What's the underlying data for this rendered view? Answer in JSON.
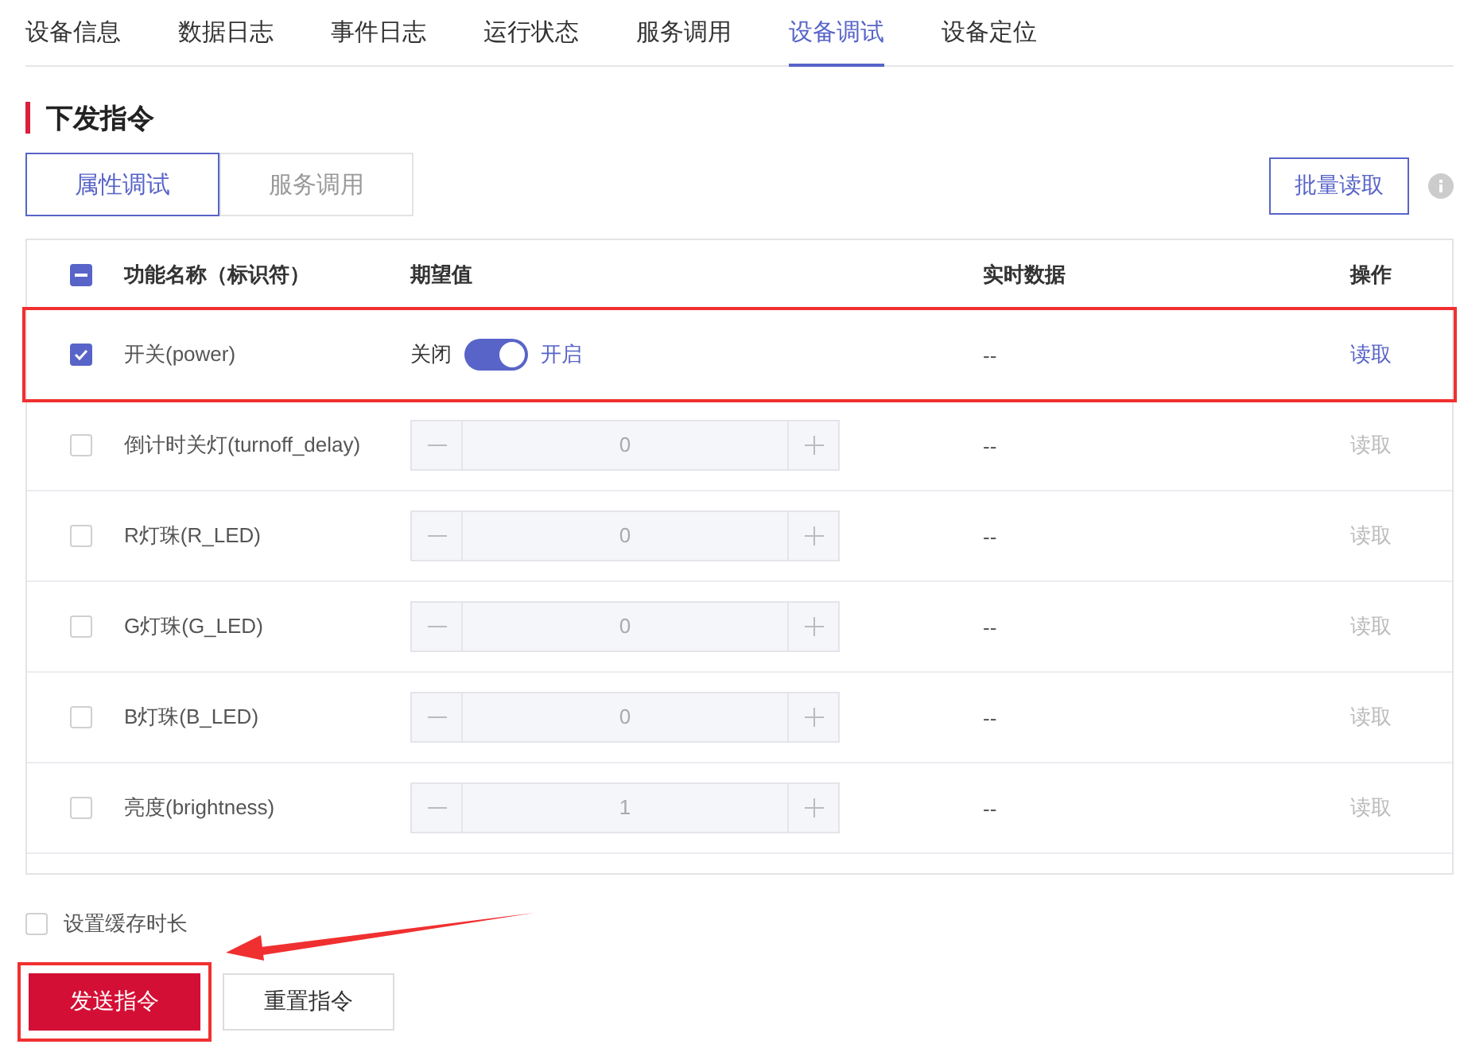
{
  "tabs": [
    {
      "label": "设备信息",
      "selected": false
    },
    {
      "label": "数据日志",
      "selected": false
    },
    {
      "label": "事件日志",
      "selected": false
    },
    {
      "label": "运行状态",
      "selected": false
    },
    {
      "label": "服务调用",
      "selected": false
    },
    {
      "label": "设备调试",
      "selected": true
    },
    {
      "label": "设备定位",
      "selected": false
    }
  ],
  "section_title": "下发指令",
  "subtabs": [
    {
      "label": "属性调试",
      "selected": true
    },
    {
      "label": "服务调用",
      "selected": false
    }
  ],
  "batch_button": "批量读取",
  "table": {
    "header_checkbox": {
      "indeterminate": true
    },
    "columns": [
      "功能名称（标识符）",
      "期望值",
      "实时数据",
      "操作"
    ],
    "rows": [
      {
        "kind": "switch",
        "checked": true,
        "highlighted": true,
        "name": "开关(power)",
        "off_label": "关闭",
        "on": true,
        "on_label": "开启",
        "realtime": "--",
        "action": "读取",
        "disabled": false
      },
      {
        "kind": "stepper",
        "checked": false,
        "highlighted": false,
        "name": "倒计时关灯(turnoff_delay)",
        "value": "0",
        "realtime": "--",
        "action": "读取",
        "disabled": true
      },
      {
        "kind": "stepper",
        "checked": false,
        "highlighted": false,
        "name": "R灯珠(R_LED)",
        "value": "0",
        "realtime": "--",
        "action": "读取",
        "disabled": true
      },
      {
        "kind": "stepper",
        "checked": false,
        "highlighted": false,
        "name": "G灯珠(G_LED)",
        "value": "0",
        "realtime": "--",
        "action": "读取",
        "disabled": true
      },
      {
        "kind": "stepper",
        "checked": false,
        "highlighted": false,
        "name": "B灯珠(B_LED)",
        "value": "0",
        "realtime": "--",
        "action": "读取",
        "disabled": true
      },
      {
        "kind": "stepper",
        "checked": false,
        "highlighted": false,
        "name": "亮度(brightness)",
        "value": "1",
        "realtime": "--",
        "action": "读取",
        "disabled": true
      }
    ]
  },
  "cache_option": {
    "label": "设置缓存时长",
    "checked": false
  },
  "buttons": [
    {
      "label": "发送指令",
      "kind": "primary",
      "highlighted": true
    },
    {
      "label": "重置指令",
      "kind": "default",
      "highlighted": false
    }
  ]
}
